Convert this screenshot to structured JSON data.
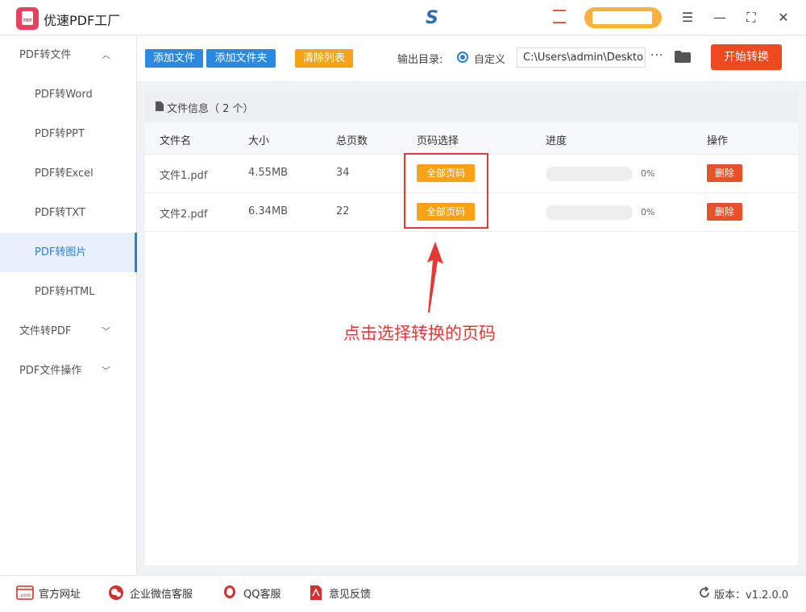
{
  "app": {
    "title": "优速PDF工厂",
    "logo_text": "PDF"
  },
  "colors": {
    "primary": "#2b89e0",
    "accent_orange": "#f7a316",
    "danger": "#e8502a",
    "start": "#ee4a20",
    "annotation": "#e53935"
  },
  "sidebar": {
    "groups": [
      {
        "label": "PDF转文件",
        "expanded": true,
        "items": [
          "PDF转Word",
          "PDF转PPT",
          "PDF转Excel",
          "PDF转TXT",
          "PDF转图片",
          "PDF转HTML"
        ]
      },
      {
        "label": "文件转PDF",
        "expanded": false
      },
      {
        "label": "PDF文件操作",
        "expanded": false
      }
    ],
    "active": "PDF转图片"
  },
  "toolbar": {
    "add_file": "添加文件",
    "add_folder": "添加文件夹",
    "clear_list": "清除列表",
    "output_label": "输出目录:",
    "radio_label": "自定义",
    "output_path": "C:\\Users\\admin\\Deskto",
    "more": "···",
    "start": "开始转换"
  },
  "file_info": {
    "header": "文件信息（ 2 个）"
  },
  "table": {
    "columns": [
      "文件名",
      "大小",
      "总页数",
      "页码选择",
      "进度",
      "操作"
    ],
    "rows": [
      {
        "name": "文件1.pdf",
        "size": "4.55MB",
        "pages": "34",
        "page_select": "全部页码",
        "progress": 0,
        "progress_text": "0%",
        "action": "删除"
      },
      {
        "name": "文件2.pdf",
        "size": "6.34MB",
        "pages": "22",
        "page_select": "全部页码",
        "progress": 0,
        "progress_text": "0%",
        "action": "删除"
      }
    ]
  },
  "annotation": {
    "text": "点击选择转换的页码"
  },
  "footer": {
    "website": "官方网址",
    "wechat": "企业微信客服",
    "qq": "QQ客服",
    "feedback": "意见反馈",
    "version": "版本：v1.2.0.0",
    "website_icon_text": ".com"
  }
}
